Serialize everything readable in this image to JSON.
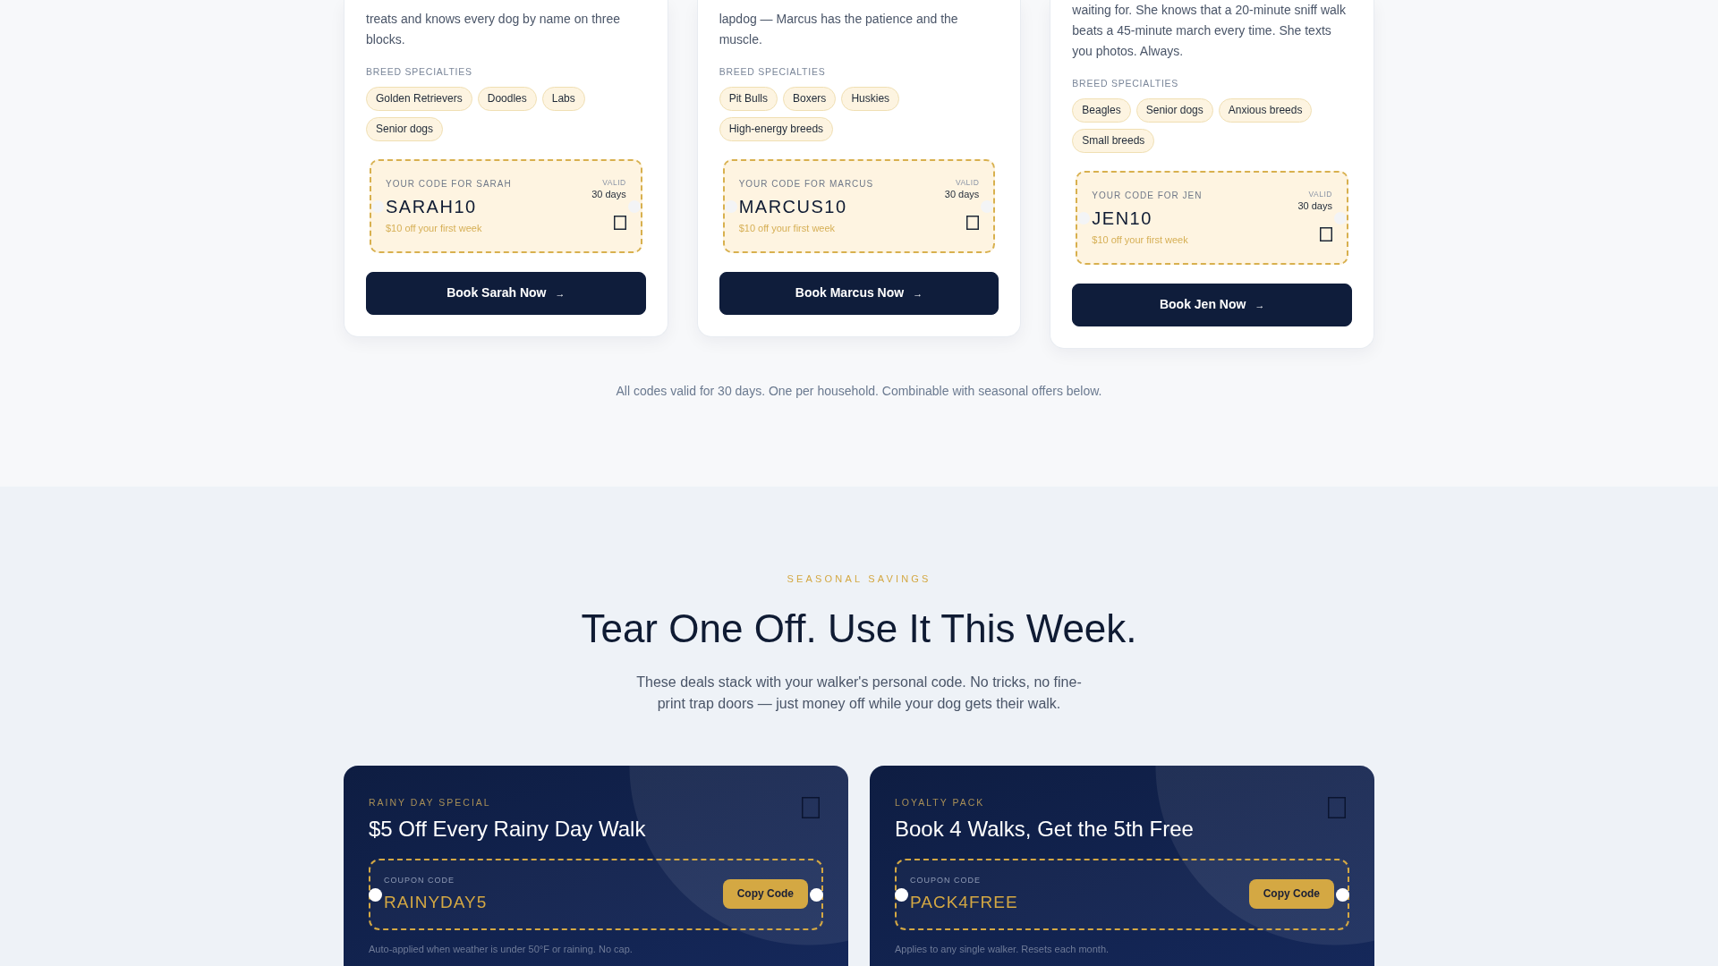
{
  "walker_cards": [
    {
      "bio": "treats and knows every dog by name on three blocks.",
      "specialties_label": "BREED SPECIALTIES",
      "specialties": [
        "Golden Retrievers",
        "Doodles",
        "Labs",
        "Senior dogs"
      ],
      "coupon": {
        "label": "YOUR CODE FOR SARAH",
        "code": "SARAH10",
        "detail": "$10 off your first week",
        "valid_label": "VALID",
        "valid_value": "30 days"
      },
      "button": {
        "label": "Book Sarah Now",
        "arrow": "→"
      }
    },
    {
      "bio": "lapdog — Marcus has the patience and the muscle.",
      "specialties_label": "BREED SPECIALTIES",
      "specialties": [
        "Pit Bulls",
        "Boxers",
        "Huskies",
        "High-energy breeds"
      ],
      "coupon": {
        "label": "YOUR CODE FOR MARCUS",
        "code": "MARCUS10",
        "detail": "$10 off your first week",
        "valid_label": "VALID",
        "valid_value": "30 days"
      },
      "button": {
        "label": "Book Marcus Now",
        "arrow": "→"
      }
    },
    {
      "bio": "waiting for. She knows that a 20-minute sniff walk beats a 45-minute march every time. She texts you photos. Always.",
      "specialties_label": "BREED SPECIALTIES",
      "specialties": [
        "Beagles",
        "Senior dogs",
        "Anxious breeds",
        "Small breeds"
      ],
      "coupon": {
        "label": "YOUR CODE FOR JEN",
        "code": "JEN10",
        "detail": "$10 off your first week",
        "valid_label": "VALID",
        "valid_value": "30 days"
      },
      "button": {
        "label": "Book Jen Now",
        "arrow": "→"
      }
    }
  ],
  "codes_note": "All codes valid for 30 days. One per household. Combinable with seasonal offers below.",
  "seasonal": {
    "eyebrow": "SEASONAL SAVINGS",
    "title": "Tear One Off. Use It This Week.",
    "description": "These deals stack with your walker's personal code. No tricks, no fine-print trap doors — just money off while your dog gets their walk.",
    "offers": [
      {
        "eyebrow": "RAINY DAY SPECIAL",
        "title": "$5 Off Every Rainy Day Walk",
        "code_label": "COUPON CODE",
        "code": "RAINYDAY5",
        "button": "Copy Code",
        "note": "Auto-applied when weather is under 50°F or raining. No cap."
      },
      {
        "eyebrow": "LOYALTY PACK",
        "title": "Book 4 Walks, Get the 5th Free",
        "code_label": "COUPON CODE",
        "code": "PACK4FREE",
        "button": "Copy Code",
        "note": "Applies to any single walker. Resets each month."
      }
    ]
  }
}
